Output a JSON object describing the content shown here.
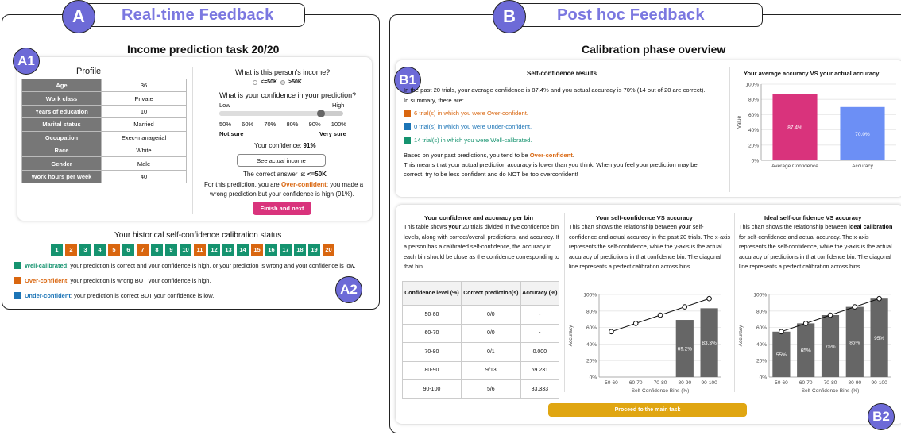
{
  "headers": {
    "a_letter": "A",
    "a_label": "Real-time Feedback",
    "b_letter": "B",
    "b_label": "Post hoc Feedback",
    "a1": "A1",
    "a2": "A2",
    "b1": "B1",
    "b2": "B2"
  },
  "colors": {
    "accent": "#6d6ad7",
    "header_text": "#7b78e0",
    "well": "#15936f",
    "over": "#d9660f",
    "under": "#1b74b6",
    "pink": "#d9337c",
    "blue_bar": "#6c8ff5",
    "gold": "#e0a612"
  },
  "taskA": {
    "title": "Income prediction task 20/20",
    "profile_title": "Profile",
    "profile": [
      {
        "k": "Age",
        "v": "36"
      },
      {
        "k": "Work class",
        "v": "Private"
      },
      {
        "k": "Years of education",
        "v": "10"
      },
      {
        "k": "Marital status",
        "v": "Married"
      },
      {
        "k": "Occupation",
        "v": "Exec-managerial"
      },
      {
        "k": "Race",
        "v": "White"
      },
      {
        "k": "Gender",
        "v": "Male"
      },
      {
        "k": "Work hours per week",
        "v": "40"
      }
    ],
    "question": "What is this person's income?",
    "opt1": "<=50K",
    "opt2": ">50K",
    "conf_question": "What is your confidence in your prediction?",
    "low": "Low",
    "high": "High",
    "ticks": [
      "50%",
      "60%",
      "70%",
      "80%",
      "90%",
      "100%"
    ],
    "slider_value": 0.91,
    "not_sure": "Not sure",
    "very_sure": "Very sure",
    "conf_label": "Your confidence:",
    "conf_value": "91%",
    "see_income": "See actual income",
    "answer_label": "The correct answer is:",
    "answer_value": "<=50K",
    "fb1_pre": "For this prediction, you are",
    "fb1_status": "Over-confident",
    "fb1_post": ": you made a",
    "fb2": "wrong prediction but your confidence is high (91%).",
    "finish": "Finish and next"
  },
  "history": {
    "title": "Your historical self-confidence calibration status",
    "trials": [
      {
        "n": "1",
        "s": "well"
      },
      {
        "n": "2",
        "s": "over"
      },
      {
        "n": "3",
        "s": "well"
      },
      {
        "n": "4",
        "s": "well"
      },
      {
        "n": "5",
        "s": "over"
      },
      {
        "n": "6",
        "s": "well"
      },
      {
        "n": "7",
        "s": "over"
      },
      {
        "n": "8",
        "s": "well"
      },
      {
        "n": "9",
        "s": "well"
      },
      {
        "n": "10",
        "s": "well"
      },
      {
        "n": "11",
        "s": "over"
      },
      {
        "n": "12",
        "s": "well"
      },
      {
        "n": "13",
        "s": "well"
      },
      {
        "n": "14",
        "s": "well"
      },
      {
        "n": "15",
        "s": "over"
      },
      {
        "n": "16",
        "s": "well"
      },
      {
        "n": "17",
        "s": "well"
      },
      {
        "n": "18",
        "s": "well"
      },
      {
        "n": "19",
        "s": "well"
      },
      {
        "n": "20",
        "s": "over"
      }
    ],
    "legend": [
      {
        "label": "Well-calibrated",
        "text": ": your prediction is correct and your confidence is high, or your prediction is wrong and your confidence is low.",
        "s": "well"
      },
      {
        "label": "Over-confident",
        "text": ": your prediction is wrong BUT your confidence is high.",
        "s": "over"
      },
      {
        "label": "Under-confident",
        "text": ": your prediction is correct BUT your confidence is low.",
        "s": "under"
      }
    ]
  },
  "overview": {
    "title": "Calibration phase overview",
    "sc_title": "Self-confidence results",
    "line1": "In the past 20 trials, your average confidence is 87.4% and you actual accuracy is 70% (14 out of 20 are correct).",
    "line2": "In summary, there are:",
    "over": "6 trial(s) in which you were Over-confident.",
    "under": "0 trial(s) in which you were Under-confident.",
    "well": "14 trial(s) in which you were Well-calibrated.",
    "tend_pre": "Based on your past predictions, you tend to be",
    "tend_status": "Over-confident",
    "tend_post": ".",
    "means1": "This means that your actual prediction accuracy is lower than you think. When you feel your prediction may be",
    "means2": "correct, try to be less confident and do NOT be too overconfident!",
    "chart_title": "Your average accuracy VS your actual accuracy",
    "proceed": "Proceed to the main task"
  },
  "bins_col": {
    "title": "Your confidence and accuracy per bin",
    "text_pre": "This table shows",
    "text_bold": "your",
    "text_post": "20 trials divided in five confidence bin levels, along with correct/overall predictions, and accuracy. If a person has a calibrated self-confidence, the accuracy in each bin should be close as the confidence corresponding to that bin.",
    "headers": [
      "Confidence level (%)",
      "Correct prediction(s)",
      "Accuracy (%)"
    ],
    "rows": [
      [
        "50-60",
        "0/0",
        "-"
      ],
      [
        "60-70",
        "0/0",
        "-"
      ],
      [
        "70-80",
        "0/1",
        "0.000"
      ],
      [
        "80-90",
        "9/13",
        "69.231"
      ],
      [
        "90-100",
        "5/6",
        "83.333"
      ]
    ]
  },
  "self_col": {
    "title": "Your self-confidence VS accuracy",
    "t1": "This chart shows the relationship between",
    "t1b": "your",
    "t1c": "self-confidence and actual accuracy in the past 20 trials. The x-axis represents the self-confidence, while the y-axis is the actual accuracy of predictions in that confidence bin. The diagonal line represents a perfect calibration across bins."
  },
  "ideal_col": {
    "title": "Ideal self-confidence VS accuracy",
    "t1": "This chart shows the relationship between",
    "t1b": "ideal calibration",
    "t1c": "for self-confidence and actual accuracy. The x-axis represents the self-confidence, while the y-axis is the actual accuracy of predictions in that confidence bin. The diagonal line represents a perfect calibration across bins."
  },
  "chart_data": [
    {
      "type": "bar",
      "title": "Your average accuracy VS your actual accuracy",
      "categories": [
        "Average Confidence",
        "Accuracy"
      ],
      "values": [
        87.4,
        70.0
      ],
      "labels": [
        "87.4%",
        "70.0%"
      ],
      "ylabel": "Value",
      "ylim": [
        0,
        100
      ],
      "yticks": [
        "0%",
        "20%",
        "40%",
        "60%",
        "80%",
        "100%"
      ],
      "colors": [
        "#d9337c",
        "#6c8ff5"
      ]
    },
    {
      "type": "bar",
      "title": "Your self-confidence VS accuracy",
      "categories": [
        "50-60",
        "60-70",
        "70-80",
        "80-90",
        "90-100"
      ],
      "values": [
        null,
        null,
        null,
        69.2,
        83.3
      ],
      "labels": [
        "",
        "",
        "",
        "69.2%",
        "83.3%"
      ],
      "diagonal": [
        55,
        65,
        75,
        85,
        95
      ],
      "xlabel": "Self-Confidence Bins (%)",
      "ylabel": "Accuracy",
      "ylim": [
        0,
        100
      ],
      "yticks": [
        "0%",
        "20%",
        "40%",
        "60%",
        "80%",
        "100%"
      ]
    },
    {
      "type": "bar",
      "title": "Ideal self-confidence VS accuracy",
      "categories": [
        "50-60",
        "60-70",
        "70-80",
        "80-90",
        "90-100"
      ],
      "values": [
        55,
        65,
        75,
        85,
        95
      ],
      "labels": [
        "55%",
        "65%",
        "75%",
        "85%",
        "95%"
      ],
      "diagonal": [
        55,
        65,
        75,
        85,
        95
      ],
      "xlabel": "Self-Confidence Bins (%)",
      "ylabel": "Accuracy",
      "ylim": [
        0,
        100
      ],
      "yticks": [
        "0%",
        "20%",
        "40%",
        "60%",
        "80%",
        "100%"
      ]
    }
  ]
}
